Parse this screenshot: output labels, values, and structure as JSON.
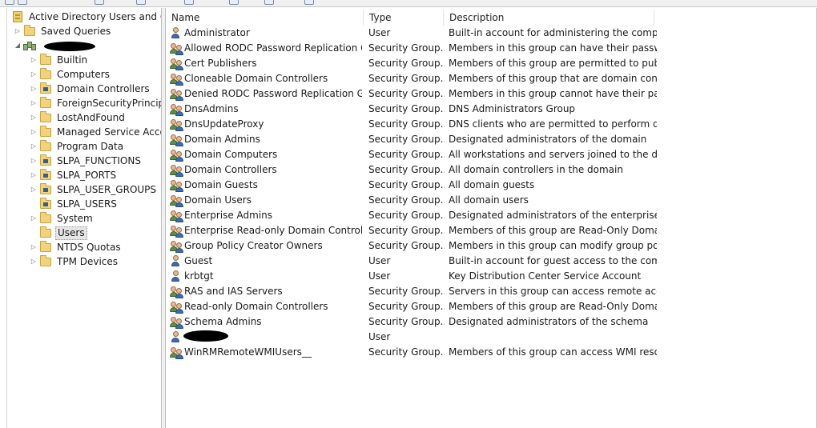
{
  "tree": {
    "root_label": "Active Directory Users and Com",
    "items": [
      {
        "label": "Saved Queries",
        "expander": "collapsed",
        "icon": "folder-icon"
      },
      {
        "label": "",
        "expander": "expanded",
        "icon": "domain-icon",
        "redacted": true
      },
      {
        "label": "Builtin",
        "expander": "collapsed",
        "icon": "folder-icon"
      },
      {
        "label": "Computers",
        "expander": "collapsed",
        "icon": "folder-icon"
      },
      {
        "label": "Domain Controllers",
        "expander": "collapsed",
        "icon": "ou-folder-icon"
      },
      {
        "label": "ForeignSecurityPrincipals",
        "expander": "collapsed",
        "icon": "folder-icon"
      },
      {
        "label": "LostAndFound",
        "expander": "collapsed",
        "icon": "folder-icon"
      },
      {
        "label": "Managed Service Accoun",
        "expander": "collapsed",
        "icon": "folder-icon"
      },
      {
        "label": "Program Data",
        "expander": "collapsed",
        "icon": "folder-icon"
      },
      {
        "label": "SLPA_FUNCTIONS",
        "expander": "collapsed",
        "icon": "ou-folder-icon"
      },
      {
        "label": "SLPA_PORTS",
        "expander": "collapsed",
        "icon": "ou-folder-icon"
      },
      {
        "label": "SLPA_USER_GROUPS",
        "expander": "collapsed",
        "icon": "ou-folder-icon"
      },
      {
        "label": "SLPA_USERS",
        "expander": "none",
        "icon": "ou-folder-icon"
      },
      {
        "label": "System",
        "expander": "collapsed",
        "icon": "folder-icon"
      },
      {
        "label": "Users",
        "expander": "none",
        "icon": "folder-icon",
        "selected": true
      },
      {
        "label": "NTDS Quotas",
        "expander": "collapsed",
        "icon": "folder-icon"
      },
      {
        "label": "TPM Devices",
        "expander": "collapsed",
        "icon": "folder-icon"
      }
    ]
  },
  "list": {
    "columns": {
      "name": "Name",
      "type": "Type",
      "description": "Description"
    },
    "rows": [
      {
        "name": "Administrator",
        "type": "User",
        "description": "Built-in account for administering the compu...",
        "kind": "user"
      },
      {
        "name": "Allowed RODC Password Replication Gr...",
        "type": "Security Group...",
        "description": "Members in this group can have their passwo...",
        "kind": "group"
      },
      {
        "name": "Cert Publishers",
        "type": "Security Group...",
        "description": "Members of this group are permitted to publi...",
        "kind": "group"
      },
      {
        "name": "Cloneable Domain Controllers",
        "type": "Security Group...",
        "description": "Members of this group that are domain contr...",
        "kind": "group"
      },
      {
        "name": "Denied RODC Password Replication Gro...",
        "type": "Security Group...",
        "description": "Members in this group cannot have their pass...",
        "kind": "group"
      },
      {
        "name": "DnsAdmins",
        "type": "Security Group...",
        "description": "DNS Administrators Group",
        "kind": "group"
      },
      {
        "name": "DnsUpdateProxy",
        "type": "Security Group...",
        "description": "DNS clients who are permitted to perform dy...",
        "kind": "group"
      },
      {
        "name": "Domain Admins",
        "type": "Security Group...",
        "description": "Designated administrators of the domain",
        "kind": "group"
      },
      {
        "name": "Domain Computers",
        "type": "Security Group...",
        "description": "All workstations and servers joined to the do...",
        "kind": "group"
      },
      {
        "name": "Domain Controllers",
        "type": "Security Group...",
        "description": "All domain controllers in the domain",
        "kind": "group"
      },
      {
        "name": "Domain Guests",
        "type": "Security Group...",
        "description": "All domain guests",
        "kind": "group"
      },
      {
        "name": "Domain Users",
        "type": "Security Group...",
        "description": "All domain users",
        "kind": "group"
      },
      {
        "name": "Enterprise Admins",
        "type": "Security Group...",
        "description": "Designated administrators of the enterprise",
        "kind": "group"
      },
      {
        "name": "Enterprise Read-only Domain Controllers",
        "type": "Security Group...",
        "description": "Members of this group are Read-Only Domai...",
        "kind": "group"
      },
      {
        "name": "Group Policy Creator Owners",
        "type": "Security Group...",
        "description": "Members in this group can modify group poli...",
        "kind": "group"
      },
      {
        "name": "Guest",
        "type": "User",
        "description": "Built-in account for guest access to the comp...",
        "kind": "user"
      },
      {
        "name": "krbtgt",
        "type": "User",
        "description": "Key Distribution Center Service Account",
        "kind": "user"
      },
      {
        "name": "RAS and IAS Servers",
        "type": "Security Group...",
        "description": "Servers in this group can access remote acces...",
        "kind": "group"
      },
      {
        "name": "Read-only Domain Controllers",
        "type": "Security Group...",
        "description": "Members of this group are Read-Only Domai...",
        "kind": "group"
      },
      {
        "name": "Schema Admins",
        "type": "Security Group...",
        "description": "Designated administrators of the schema",
        "kind": "group"
      },
      {
        "name": "",
        "type": "User",
        "description": "",
        "kind": "user",
        "redacted": true
      },
      {
        "name": "WinRMRemoteWMIUsers__",
        "type": "Security Group...",
        "description": "Members of this group can access WMI resou...",
        "kind": "group"
      }
    ]
  }
}
